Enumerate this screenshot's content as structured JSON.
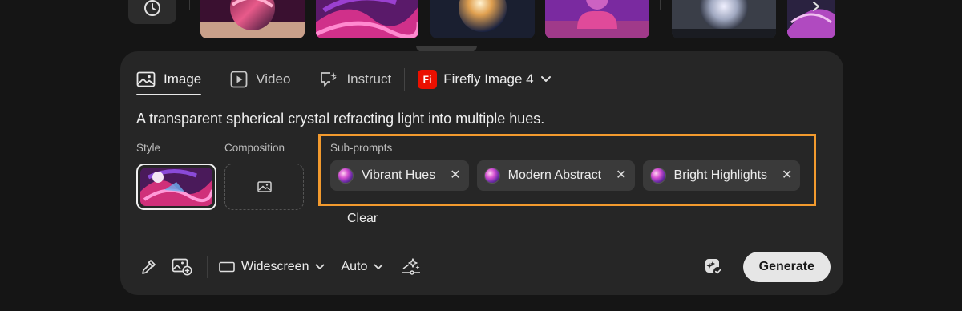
{
  "tabs": [
    {
      "label": "Image",
      "icon": "image-icon",
      "active": true
    },
    {
      "label": "Video",
      "icon": "video-icon",
      "active": false
    },
    {
      "label": "Instruct",
      "icon": "instruct-icon",
      "active": false
    }
  ],
  "model": {
    "badge": "Fi",
    "label": "Firefly Image 4"
  },
  "prompt": "A transparent spherical crystal refracting light into multiple hues.",
  "style_label": "Style",
  "composition_label": "Composition",
  "subprompts": {
    "label": "Sub-prompts",
    "items": [
      "Vibrant Hues",
      "Modern Abstract",
      "Bright Highlights"
    ],
    "remove_glyph": "✕",
    "clear_label": "Clear"
  },
  "toolbar": {
    "aspect_label": "Widescreen",
    "content_type_label": "Auto",
    "generate_label": "Generate"
  },
  "colors": {
    "highlight_border": "#f29a2e",
    "firefly_badge": "#eb1000",
    "panel_bg": "#262626",
    "page_bg": "#151515"
  }
}
